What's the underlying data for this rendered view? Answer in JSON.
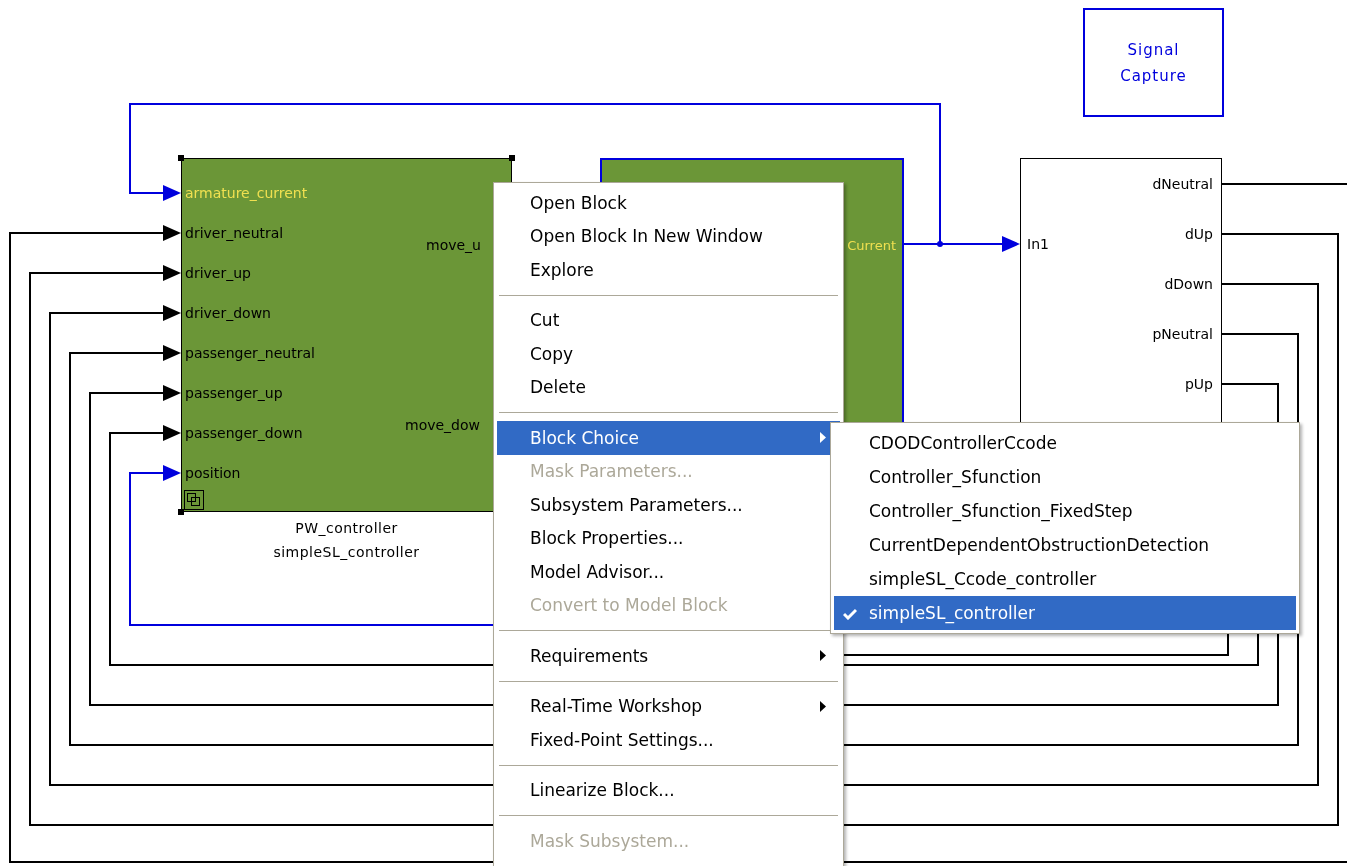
{
  "diagram": {
    "pw_block": {
      "title": "PW_controller",
      "subtitle": "simpleSL_controller",
      "selected": true,
      "inputs": [
        {
          "label": "armature_current",
          "color": "#f0e050"
        },
        {
          "label": "driver_neutral",
          "color": "#000000"
        },
        {
          "label": "driver_up",
          "color": "#000000"
        },
        {
          "label": "driver_down",
          "color": "#000000"
        },
        {
          "label": "passenger_neutral",
          "color": "#000000"
        },
        {
          "label": "passenger_up",
          "color": "#000000"
        },
        {
          "label": "passenger_down",
          "color": "#000000"
        },
        {
          "label": "position",
          "color": "#000000"
        }
      ],
      "outputs": [
        "move_u",
        "move_dow"
      ]
    },
    "second_block": {
      "output": "Current"
    },
    "signal_capture": {
      "label": "Signal Capture"
    },
    "logic_block": {
      "inputs": [
        "In1"
      ],
      "outputs": [
        "dNeutral",
        "dUp",
        "dDown",
        "pNeutral",
        "pUp"
      ]
    }
  },
  "context_menu": {
    "items": [
      {
        "kind": "item",
        "label": "Open Block",
        "disabled": false,
        "selected": false
      },
      {
        "kind": "item",
        "label": "Open Block In New Window",
        "disabled": false,
        "selected": false
      },
      {
        "kind": "item",
        "label": "Explore",
        "disabled": false,
        "selected": false
      },
      {
        "kind": "separator"
      },
      {
        "kind": "item",
        "label": "Cut",
        "disabled": false,
        "selected": false
      },
      {
        "kind": "item",
        "label": "Copy",
        "disabled": false,
        "selected": false
      },
      {
        "kind": "item",
        "label": "Delete",
        "disabled": false,
        "selected": false
      },
      {
        "kind": "separator"
      },
      {
        "kind": "submenu",
        "label": "Block Choice",
        "disabled": false,
        "selected": true
      },
      {
        "kind": "item",
        "label": "Mask Parameters...",
        "disabled": true,
        "selected": false
      },
      {
        "kind": "item",
        "label": "Subsystem Parameters...",
        "disabled": false,
        "selected": false
      },
      {
        "kind": "item",
        "label": "Block Properties...",
        "disabled": false,
        "selected": false
      },
      {
        "kind": "item",
        "label": "Model Advisor...",
        "disabled": false,
        "selected": false
      },
      {
        "kind": "item",
        "label": "Convert to Model Block",
        "disabled": true,
        "selected": false
      },
      {
        "kind": "separator"
      },
      {
        "kind": "submenu",
        "label": "Requirements",
        "disabled": false,
        "selected": false
      },
      {
        "kind": "separator"
      },
      {
        "kind": "submenu",
        "label": "Real-Time Workshop",
        "disabled": false,
        "selected": false
      },
      {
        "kind": "item",
        "label": "Fixed-Point Settings...",
        "disabled": false,
        "selected": false
      },
      {
        "kind": "separator"
      },
      {
        "kind": "item",
        "label": "Linearize Block...",
        "disabled": false,
        "selected": false
      },
      {
        "kind": "separator"
      },
      {
        "kind": "item",
        "label": "Mask Subsystem...",
        "disabled": true,
        "selected": false
      }
    ]
  },
  "block_choice_submenu": {
    "items": [
      {
        "label": "CDODControllerCcode",
        "checked": false,
        "selected": false
      },
      {
        "label": "Controller_Sfunction",
        "checked": false,
        "selected": false
      },
      {
        "label": "Controller_Sfunction_FixedStep",
        "checked": false,
        "selected": false
      },
      {
        "label": "CurrentDependentObstructionDetection",
        "checked": false,
        "selected": false
      },
      {
        "label": "simpleSL_Ccode_controller",
        "checked": false,
        "selected": false
      },
      {
        "label": "simpleSL_controller",
        "checked": true,
        "selected": true
      }
    ]
  }
}
